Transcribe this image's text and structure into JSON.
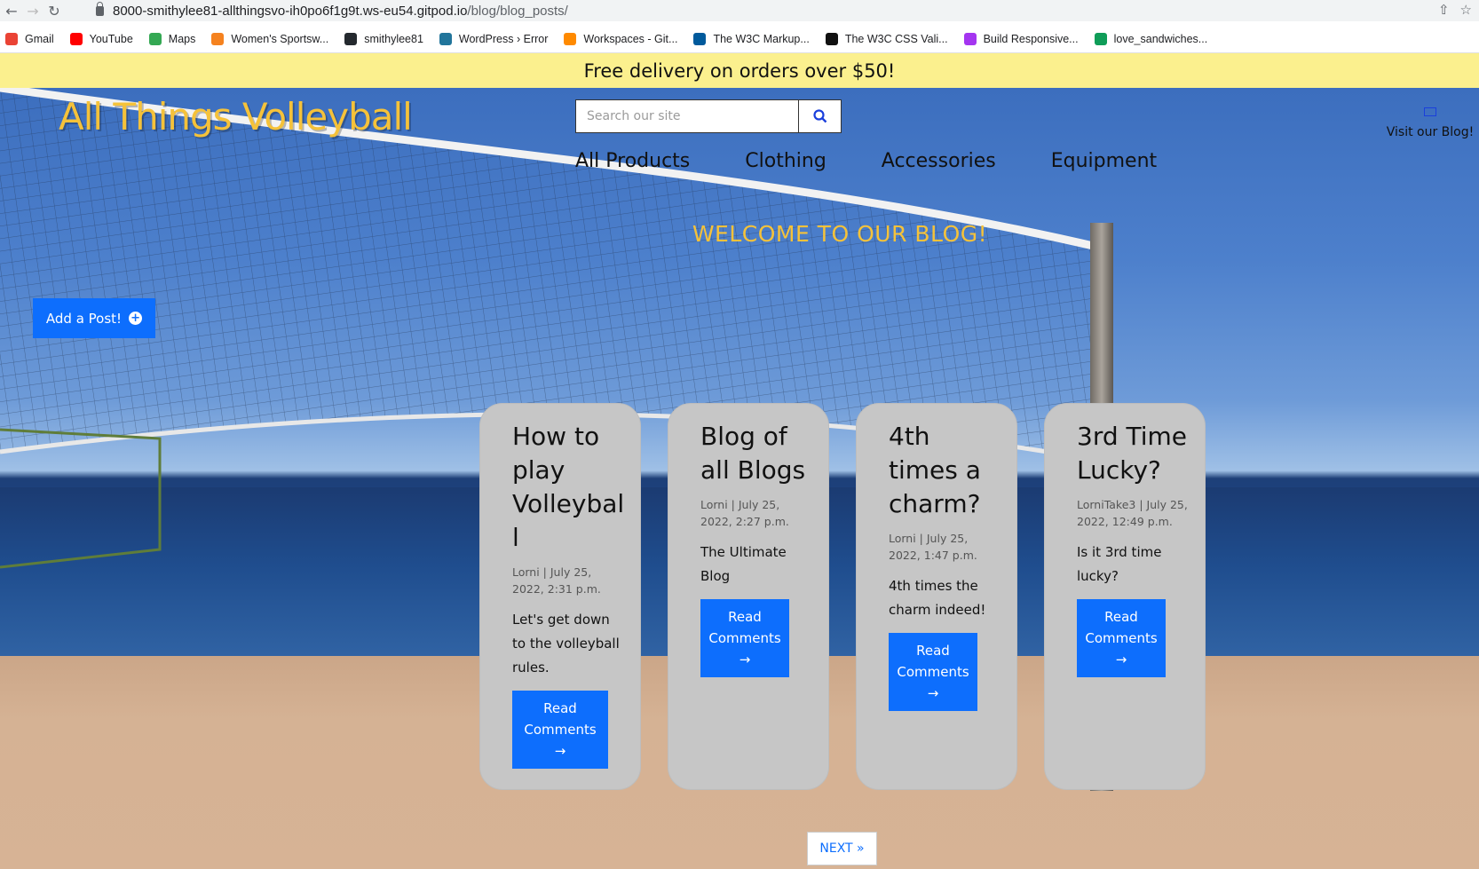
{
  "browser": {
    "url_host": "8000-smithylee81-allthingsvo-ih0po6f1g9t.ws-eu54.gitpod.io",
    "url_path": "/blog/blog_posts/",
    "bookmarks": [
      {
        "label": "Gmail",
        "icon": "gmail-icon",
        "color": "#ea4335"
      },
      {
        "label": "YouTube",
        "icon": "youtube-icon",
        "color": "#ff0000"
      },
      {
        "label": "Maps",
        "icon": "maps-icon",
        "color": "#34a853"
      },
      {
        "label": "Women's Sportsw...",
        "icon": "sportswear-icon",
        "color": "#f5821f"
      },
      {
        "label": "smithylee81",
        "icon": "github-icon",
        "color": "#24292e"
      },
      {
        "label": "WordPress › Error",
        "icon": "wordpress-icon",
        "color": "#21759b"
      },
      {
        "label": "Workspaces - Git...",
        "icon": "gitpod-icon",
        "color": "#ff8a00"
      },
      {
        "label": "The W3C Markup...",
        "icon": "w3c-icon",
        "color": "#005a9c"
      },
      {
        "label": "The W3C CSS Vali...",
        "icon": "w3c-css-icon",
        "color": "#111111"
      },
      {
        "label": "Build Responsive...",
        "icon": "udemy-icon",
        "color": "#a435f0"
      },
      {
        "label": "love_sandwiches...",
        "icon": "sheets-icon",
        "color": "#0f9d58"
      }
    ]
  },
  "banner": {
    "text": "Free delivery on orders over $50!"
  },
  "header": {
    "logo": "All Things Volleyball",
    "search_placeholder": "Search our site",
    "blog_link": "Visit our Blog!",
    "nav": [
      "All Products",
      "Clothing",
      "Accessories",
      "Equipment"
    ]
  },
  "welcome": "WELCOME TO OUR BLOG!",
  "add_post": "Add a Post!",
  "posts": [
    {
      "title": "How to play Volleyball",
      "meta": "Lorni | July 25, 2022, 2:31 p.m.",
      "text": "Let's get down to the volleyball rules.",
      "button": "Read Comments →"
    },
    {
      "title": "Blog of all Blogs",
      "meta": "Lorni | July 25, 2022, 2:27 p.m.",
      "text": "The Ultimate Blog",
      "button": "Read Comments →"
    },
    {
      "title": "4th times a charm?",
      "meta": "Lorni | July 25, 2022, 1:47 p.m.",
      "text": "4th times the charm indeed!",
      "button": "Read Comments →"
    },
    {
      "title": "3rd Time Lucky?",
      "meta": "LorniTake3 | July 25, 2022, 12:49 p.m.",
      "text": "Is it 3rd time lucky?",
      "button": "Read Comments →"
    }
  ],
  "pagination": {
    "next": "NEXT »"
  },
  "colors": {
    "brand_yellow": "#f5c23a",
    "banner": "#fbf08e",
    "primary_button": "#0d6efd",
    "card": "#c6c6c6"
  }
}
